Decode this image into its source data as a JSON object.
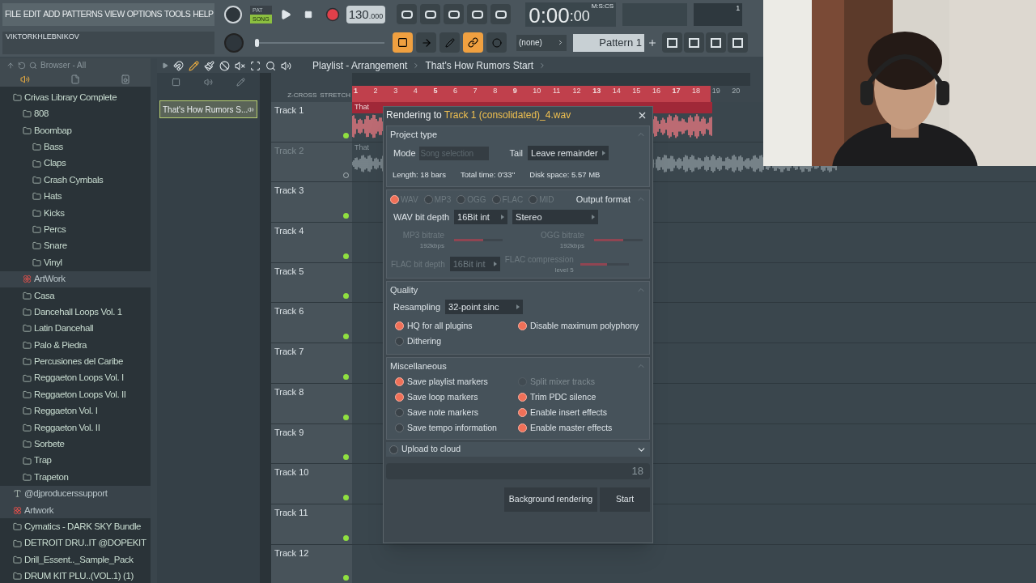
{
  "menu": [
    "FILE",
    "EDIT",
    "ADD",
    "PATTERNS",
    "VIEW",
    "OPTIONS",
    "TOOLS",
    "HELP"
  ],
  "toolbar": {
    "user": "VIKTORKHLEBNIKOV",
    "modes": [
      {
        "label": "PAT",
        "selected": false
      },
      {
        "label": "SONG",
        "selected": true
      }
    ],
    "tempo": "130",
    "tempo_fraction": ".000",
    "time": "0:00",
    "time_fraction": ":00",
    "time_unit": "M:S:CS",
    "meter_value": "1",
    "snap": "(none)",
    "pattern": "Pattern 1",
    "pitch_slider": {
      "level": 0
    },
    "toggles": [
      {
        "on": true
      },
      {
        "on": false
      },
      {
        "on": false
      },
      {
        "on": true
      },
      {
        "on": false
      }
    ]
  },
  "browser": {
    "title": "Browser - All",
    "tree": [
      {
        "name": "Crivas Library Complete",
        "kind": "folder",
        "children": [
          {
            "name": "808",
            "kind": "folder"
          },
          {
            "name": "Boombap",
            "kind": "folder",
            "children": [
              {
                "name": "Bass",
                "kind": "folder"
              },
              {
                "name": "Claps",
                "kind": "folder"
              },
              {
                "name": "Crash Cymbals",
                "kind": "folder"
              },
              {
                "name": "Hats",
                "kind": "folder"
              },
              {
                "name": "Kicks",
                "kind": "folder"
              },
              {
                "name": "Percs",
                "kind": "folder"
              },
              {
                "name": "Snare",
                "kind": "folder"
              },
              {
                "name": "Vinyl",
                "kind": "folder"
              }
            ]
          },
          {
            "name": "ArtWork"
          },
          {
            "name": "Casa",
            "kind": "folder"
          },
          {
            "name": "Dancehall Loops Vol. 1",
            "kind": "folder"
          },
          {
            "name": "Latin Dancehall",
            "kind": "folder"
          },
          {
            "name": "Palo & Piedra",
            "kind": "folder"
          },
          {
            "name": "Percusiones del Caribe",
            "kind": "folder"
          },
          {
            "name": "Reggaeton Loops Vol. I",
            "kind": "folder"
          },
          {
            "name": "Reggaeton Loops Vol. II",
            "kind": "folder"
          },
          {
            "name": "Reggaeton Vol. I",
            "kind": "folder"
          },
          {
            "name": "Reggaeton Vol. II",
            "kind": "folder"
          },
          {
            "name": "Sorbete",
            "kind": "folder"
          },
          {
            "name": "Trap",
            "kind": "folder"
          },
          {
            "name": "Trapeton",
            "kind": "folder"
          }
        ]
      },
      {
        "name": "@djproducerssupport",
        "kind": "text"
      },
      {
        "name": "Artwork"
      },
      {
        "name": "Cymatics - DARK SKY Bundle",
        "kind": "folder"
      },
      {
        "name": "DETROIT DRU..IT @DOPEKIT",
        "kind": "folder"
      },
      {
        "name": "Drill_Essent.._Sample_Pack",
        "kind": "folder"
      },
      {
        "name": "DRUM KIT PLU..(VOL.1) (1)",
        "kind": "folder"
      }
    ]
  },
  "clip_list": {
    "items": [
      "That's How Rumors S..."
    ]
  },
  "playlist": {
    "title": "Playlist - Arrangement",
    "song": "That's How Rumors Start",
    "zcross": "Z-CROSS",
    "stretch": "STRETCH",
    "bars": [
      "1",
      "2",
      "3",
      "4",
      "5",
      "6",
      "7",
      "8",
      "9",
      "10",
      "11",
      "12",
      "13",
      "14",
      "15",
      "16",
      "17",
      "18",
      "19",
      "20"
    ],
    "tracks": [
      {
        "name": "Track 1",
        "enabled": true,
        "clip": "That"
      },
      {
        "name": "Track 2",
        "enabled": false,
        "clip": "That"
      },
      {
        "name": "Track 3",
        "enabled": true
      },
      {
        "name": "Track 4",
        "enabled": true
      },
      {
        "name": "Track 5",
        "enabled": true
      },
      {
        "name": "Track 6",
        "enabled": true
      },
      {
        "name": "Track 7",
        "enabled": true
      },
      {
        "name": "Track 8",
        "enabled": true
      },
      {
        "name": "Track 9",
        "enabled": true
      },
      {
        "name": "Track 10",
        "enabled": true
      },
      {
        "name": "Track 11",
        "enabled": true
      },
      {
        "name": "Track 12",
        "enabled": true
      }
    ]
  },
  "render_dialog": {
    "title_prefix": "Rendering to",
    "file": "Track 1 (consolidated)_4.wav",
    "project_type": {
      "heading": "Project type",
      "mode_label": "Mode",
      "mode_placeholder": "Song selection",
      "tail_label": "Tail",
      "tail": "Leave remainder",
      "length": "Length: 18 bars",
      "total_time": "Total time: 0'33''",
      "disk_space": "Disk space: 5.57 MB"
    },
    "output": {
      "heading": "Output format",
      "formats": [
        {
          "label": "WAV",
          "selected": true
        },
        {
          "label": "MP3",
          "selected": false
        },
        {
          "label": "OGG",
          "selected": false
        },
        {
          "label": "FLAC",
          "selected": false
        },
        {
          "label": "MID",
          "selected": false
        }
      ],
      "wav_depth_label": "WAV bit depth",
      "wav_depth": "16Bit int",
      "channels": "Stereo",
      "mp3_label": "MP3 bitrate",
      "mp3_value": "192kbps",
      "mp3_slider": {
        "level": 0.6
      },
      "ogg_label": "OGG bitrate",
      "ogg_value": "192kbps",
      "ogg_slider": {
        "level": 0.6
      },
      "flac_depth_label": "FLAC bit depth",
      "flac_depth": "16Bit int",
      "flac_label": "FLAC compression",
      "flac_value": "level 5",
      "flac_slider": {
        "level": 0.55
      }
    },
    "quality": {
      "heading": "Quality",
      "resampling_label": "Resampling",
      "resampling": "32-point sinc",
      "options": [
        {
          "label": "HQ for all plugins",
          "checked": true,
          "disabled": false
        },
        {
          "label": "Disable maximum polyphony",
          "checked": true,
          "disabled": false
        },
        {
          "label": "Dithering",
          "checked": false,
          "disabled": false
        }
      ]
    },
    "misc": {
      "heading": "Miscellaneous",
      "options": [
        {
          "label": "Save playlist markers",
          "checked": true,
          "disabled": false
        },
        {
          "label": "Split mixer tracks",
          "checked": false,
          "disabled": true
        },
        {
          "label": "Save loop markers",
          "checked": true,
          "disabled": false
        },
        {
          "label": "Trim PDC silence",
          "checked": true,
          "disabled": false
        },
        {
          "label": "Save note markers",
          "checked": false,
          "disabled": false
        },
        {
          "label": "Enable insert effects",
          "checked": true,
          "disabled": false
        },
        {
          "label": "Save tempo information",
          "checked": false,
          "disabled": false
        },
        {
          "label": "Enable master effects",
          "checked": true,
          "disabled": false
        }
      ]
    },
    "cloud": {
      "label": "Upload to cloud",
      "checked": false
    },
    "progress": "18",
    "progress_bar": {
      "level": 0
    },
    "buttons": [
      "Background rendering",
      "Start"
    ]
  }
}
